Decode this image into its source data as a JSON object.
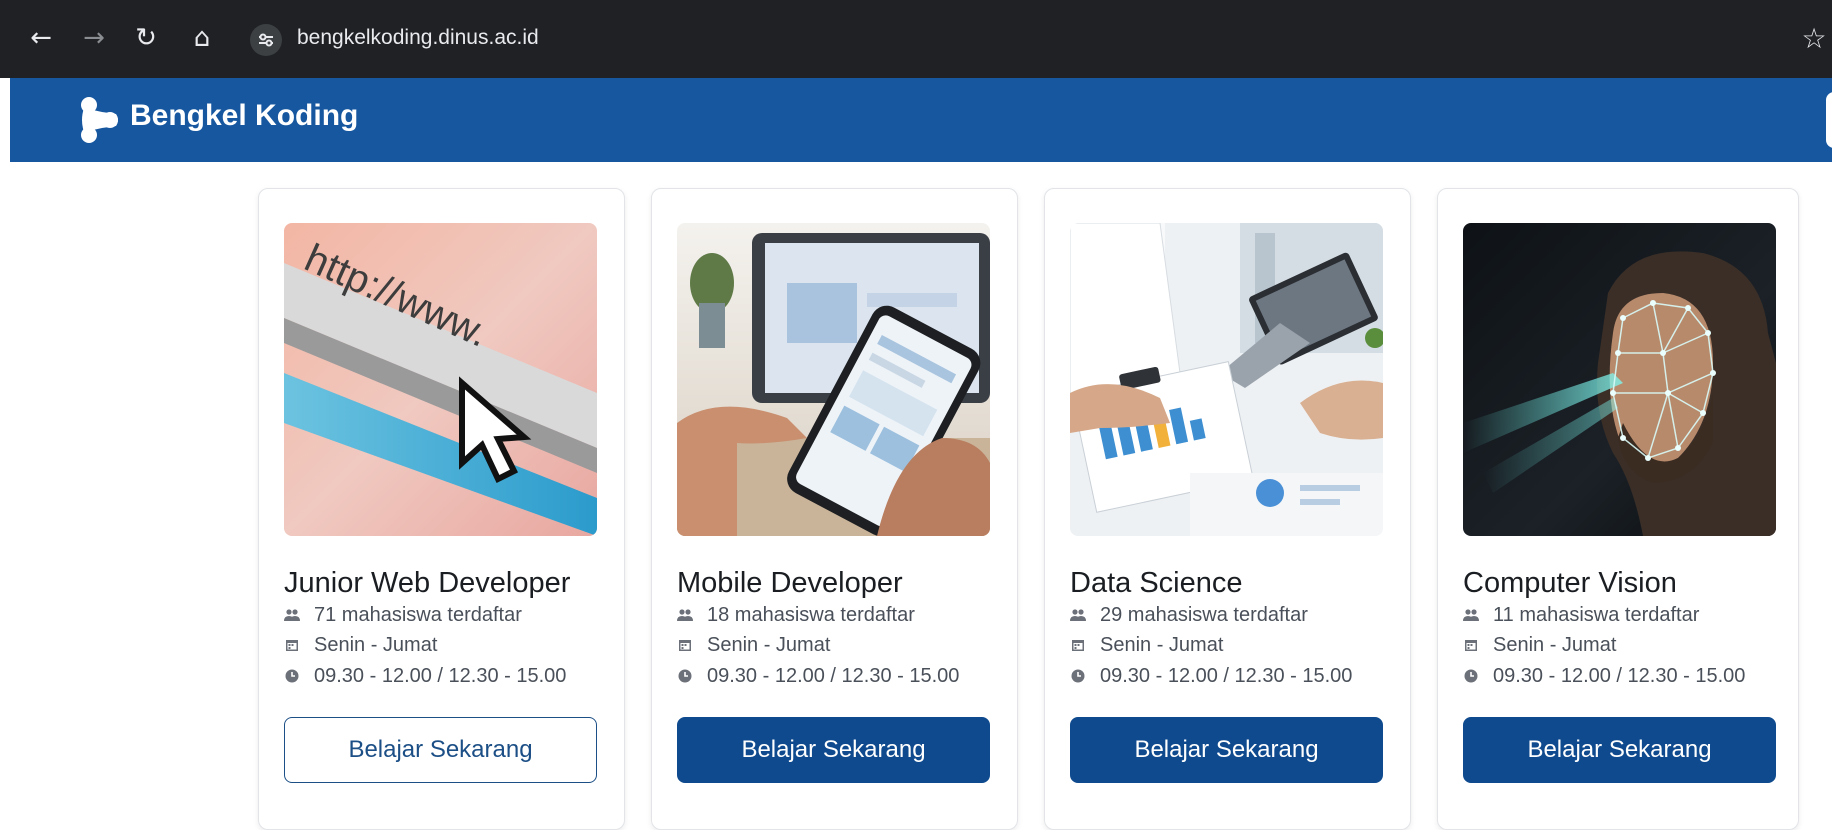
{
  "browser": {
    "url": "bengkelkoding.dinus.ac.id",
    "back_glyph": "←",
    "forward_glyph": "→",
    "reload_glyph": "↻",
    "home_glyph": "⌂",
    "star_glyph": "☆"
  },
  "header": {
    "title": "Bengkel Koding",
    "brand_color": "#1657a0"
  },
  "courses": [
    {
      "title": "Junior Web Developer",
      "students": "71 mahasiswa terdaftar",
      "days": "Senin - Jumat",
      "time": "09.30 - 12.00 / 12.30 - 15.00",
      "cta": "Belajar Sekarang",
      "cta_style": "outline",
      "image": "http-www-cursor",
      "image_text": "http://www."
    },
    {
      "title": "Mobile Developer",
      "students": "18 mahasiswa terdaftar",
      "days": "Senin - Jumat",
      "time": "09.30 - 12.00 / 12.30 - 15.00",
      "cta": "Belajar Sekarang",
      "cta_style": "solid",
      "image": "hand-holding-smartphone"
    },
    {
      "title": "Data Science",
      "students": "29 mahasiswa terdaftar",
      "days": "Senin - Jumat",
      "time": "09.30 - 12.00 / 12.30 - 15.00",
      "cta": "Belajar Sekarang",
      "cta_style": "solid",
      "image": "analysts-with-charts"
    },
    {
      "title": "Computer Vision",
      "students": "11 mahasiswa terdaftar",
      "days": "Senin - Jumat",
      "time": "09.30 - 12.00 / 12.30 - 15.00",
      "cta": "Belajar Sekarang",
      "cta_style": "solid",
      "image": "face-mesh-recognition"
    }
  ],
  "icons": {
    "students": "users-icon",
    "days": "calendar-icon",
    "time": "clock-icon"
  },
  "colors": {
    "primary_button": "#0f4a8e",
    "text": "#1a1d21",
    "meta_text": "#4a5059"
  }
}
